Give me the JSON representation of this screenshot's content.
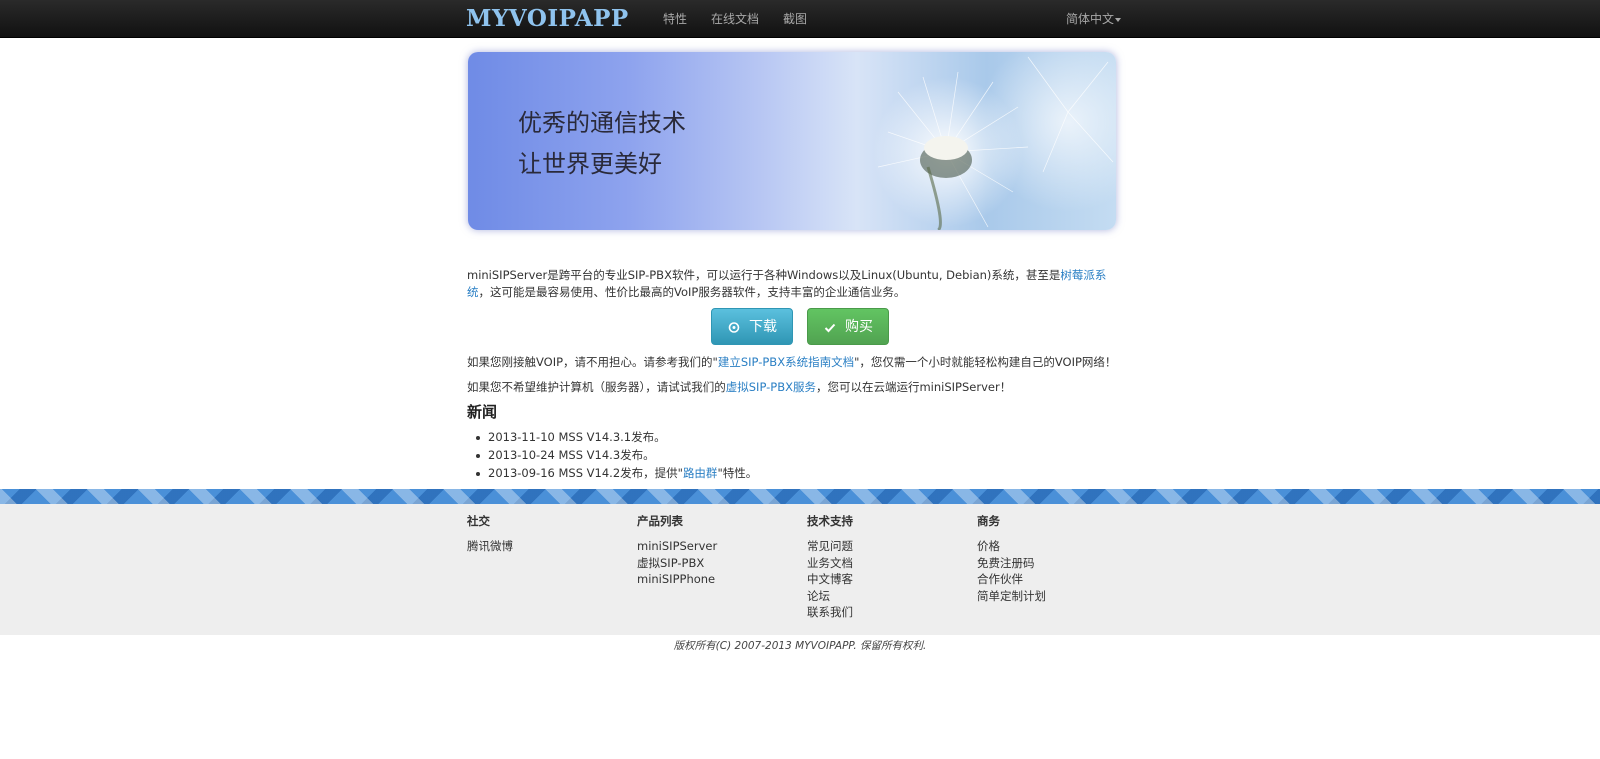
{
  "navbar": {
    "brand": "MYVOIPAPP",
    "items": [
      "特性",
      "在线文档",
      "截图"
    ],
    "language": "简体中文"
  },
  "hero": {
    "line1": "优秀的通信技术",
    "line2": "让世界更美好"
  },
  "intro": {
    "text_before": "miniSIPServer是跨平台的专业SIP-PBX软件，可以运行于各种Windows以及Linux(Ubuntu, Debian)系统，甚至是",
    "link": "树莓派系统",
    "text_after": "，这可能是最容易使用、性价比最高的VoIP服务器软件，支持丰富的企业通信业务。"
  },
  "buttons": {
    "download": "下载",
    "buy": "购买"
  },
  "guide": {
    "text_before": "如果您刚接触VOIP，请不用担心。请参考我们的\"",
    "link": "建立SIP-PBX系统指南文档",
    "text_after": "\"，您仅需一个小时就能轻松构建自己的VOIP网络！"
  },
  "cloud": {
    "text_before": "如果您不希望维护计算机（服务器），请试试我们的",
    "link": "虚拟SIP-PBX服务",
    "text_after": "，您可以在云端运行miniSIPServer！"
  },
  "news": {
    "title": "新闻",
    "items": [
      {
        "text": "2013-11-10 MSS V14.3.1发布。"
      },
      {
        "text": "2013-10-24 MSS V14.3发布。"
      },
      {
        "text_before": "2013-09-16 MSS V14.2发布，提供\"",
        "link": "路由群",
        "text_after": "\"特性。"
      }
    ]
  },
  "footer": {
    "columns": [
      {
        "title": "社交",
        "links": [
          "腾讯微博"
        ]
      },
      {
        "title": "产品列表",
        "links": [
          "miniSIPServer",
          "虚拟SIP-PBX",
          "miniSIPPhone"
        ]
      },
      {
        "title": "技术支持",
        "links": [
          "常见问题",
          "业务文档",
          "中文博客",
          "论坛",
          "联系我们"
        ]
      },
      {
        "title": "商务",
        "links": [
          "价格",
          "免费注册码",
          "合作伙伴",
          "简单定制计划"
        ]
      }
    ],
    "copyright": "版权所有(C) 2007-2013 MYVOIPAPP. 保留所有权利."
  },
  "colors": {
    "link": "#2a7fc4",
    "download_button": "#3aa6c8",
    "buy_button": "#57ad57",
    "navbar": "#1c1c1c",
    "brand": "#8fc3ee"
  }
}
